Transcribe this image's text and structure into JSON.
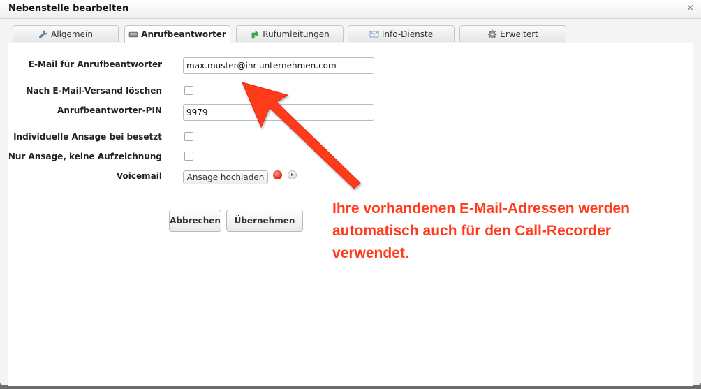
{
  "dialog": {
    "title": "Nebenstelle bearbeiten",
    "close_glyph": "×"
  },
  "tabs": [
    {
      "label": "Allgemein",
      "icon": "wrench-icon",
      "active": false
    },
    {
      "label": "Anrufbeantworter",
      "icon": "answering-machine-icon",
      "active": true
    },
    {
      "label": "Rufumleitungen",
      "icon": "forward-arrow-icon",
      "active": false
    },
    {
      "label": "Info-Dienste",
      "icon": "envelope-icon",
      "active": false
    },
    {
      "label": "Erweitert",
      "icon": "gear-icon",
      "active": false
    }
  ],
  "form": {
    "email_label": "E-Mail für Anrufbeantworter",
    "email_value": "max.muster@ihr-unternehmen.com",
    "delete_after_send_label": "Nach E-Mail-Versand löschen",
    "delete_after_send_checked": false,
    "pin_label": "Anrufbeantworter-PIN",
    "pin_value": "9979",
    "individual_greeting_label": "Individuelle Ansage bei besetzt",
    "individual_greeting_checked": false,
    "greeting_only_label": "Nur Ansage, keine Aufzeichnung",
    "greeting_only_checked": false,
    "voicemail_label": "Voicemail",
    "upload_label": "Ansage hochladen"
  },
  "buttons": {
    "cancel": "Abbrechen",
    "apply": "Übernehmen"
  },
  "annotation": {
    "line1": "Ihre vorhandenen E-Mail-Adressen werden",
    "line2": "automatisch auch für den Call-Recorder",
    "line3": "verwendet.",
    "color": "#ff3b1c"
  },
  "colors": {
    "backdrop": "#6d6d6d",
    "record_dot": "#e0331c"
  }
}
